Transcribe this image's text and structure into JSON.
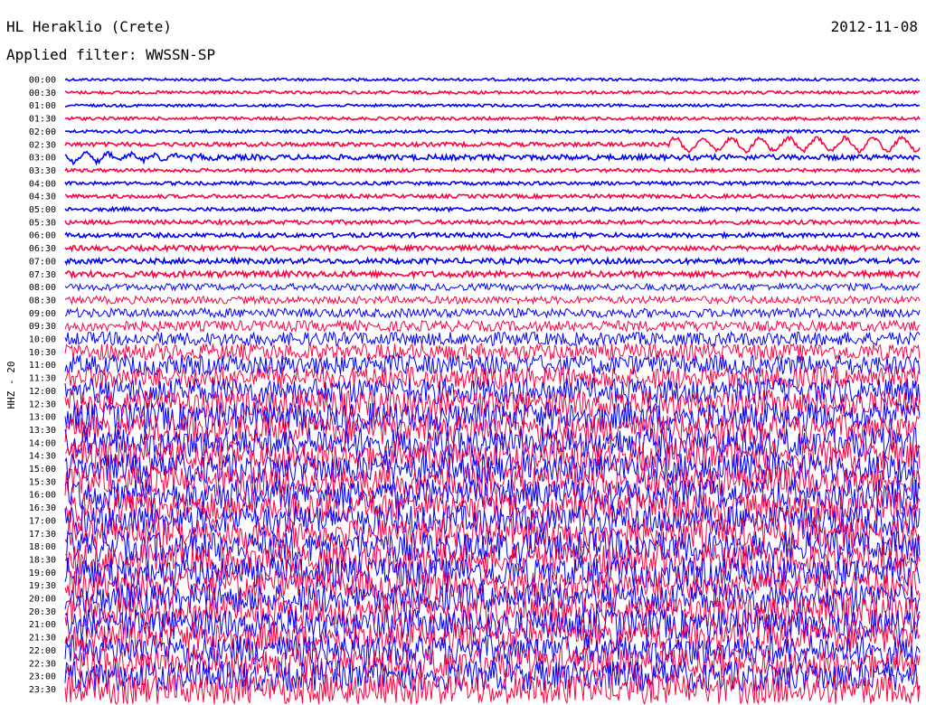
{
  "header": {
    "station": "HL Heraklio (Crete)",
    "date": "2012-11-08",
    "filter": "Applied filter: WWSSN-SP"
  },
  "chart_data": {
    "type": "line",
    "title": "HL Heraklio (Crete)",
    "subtitle": "Applied filter: WWSSN-SP",
    "date": "2012-11-08",
    "ylabel": "HHZ - 20",
    "row_labels": [
      "00:00",
      "00:30",
      "01:00",
      "01:30",
      "02:00",
      "02:30",
      "03:00",
      "03:30",
      "04:00",
      "04:30",
      "05:00",
      "05:30",
      "06:00",
      "06:30",
      "07:00",
      "07:30",
      "08:00",
      "08:30",
      "09:00",
      "09:30",
      "10:00",
      "10:30",
      "11:00",
      "11:30",
      "12:00",
      "12:30",
      "13:00",
      "13:30",
      "14:00",
      "14:30",
      "15:00",
      "15:30",
      "16:00",
      "16:30",
      "17:00",
      "17:30",
      "18:00",
      "18:30",
      "19:00",
      "19:30",
      "20:00",
      "20:30",
      "21:00",
      "21:30",
      "22:00",
      "22:30",
      "23:00",
      "23:30"
    ],
    "trace_colors": [
      "#0000ff",
      "#ff0040"
    ],
    "relative_amplitude": [
      0.35,
      0.4,
      0.35,
      0.4,
      0.4,
      0.55,
      0.7,
      0.45,
      0.45,
      0.5,
      0.5,
      0.55,
      0.6,
      0.65,
      0.7,
      0.8,
      0.9,
      1.0,
      1.2,
      1.4,
      1.8,
      2.2,
      2.6,
      3.0,
      3.4,
      3.6,
      3.8,
      4.0,
      4.0,
      4.0,
      4.0,
      4.0,
      4.0,
      4.0,
      4.0,
      4.0,
      4.0,
      4.0,
      4.0,
      4.0,
      4.0,
      4.0,
      4.0,
      4.0,
      4.0,
      4.0,
      4.0,
      4.0
    ]
  }
}
